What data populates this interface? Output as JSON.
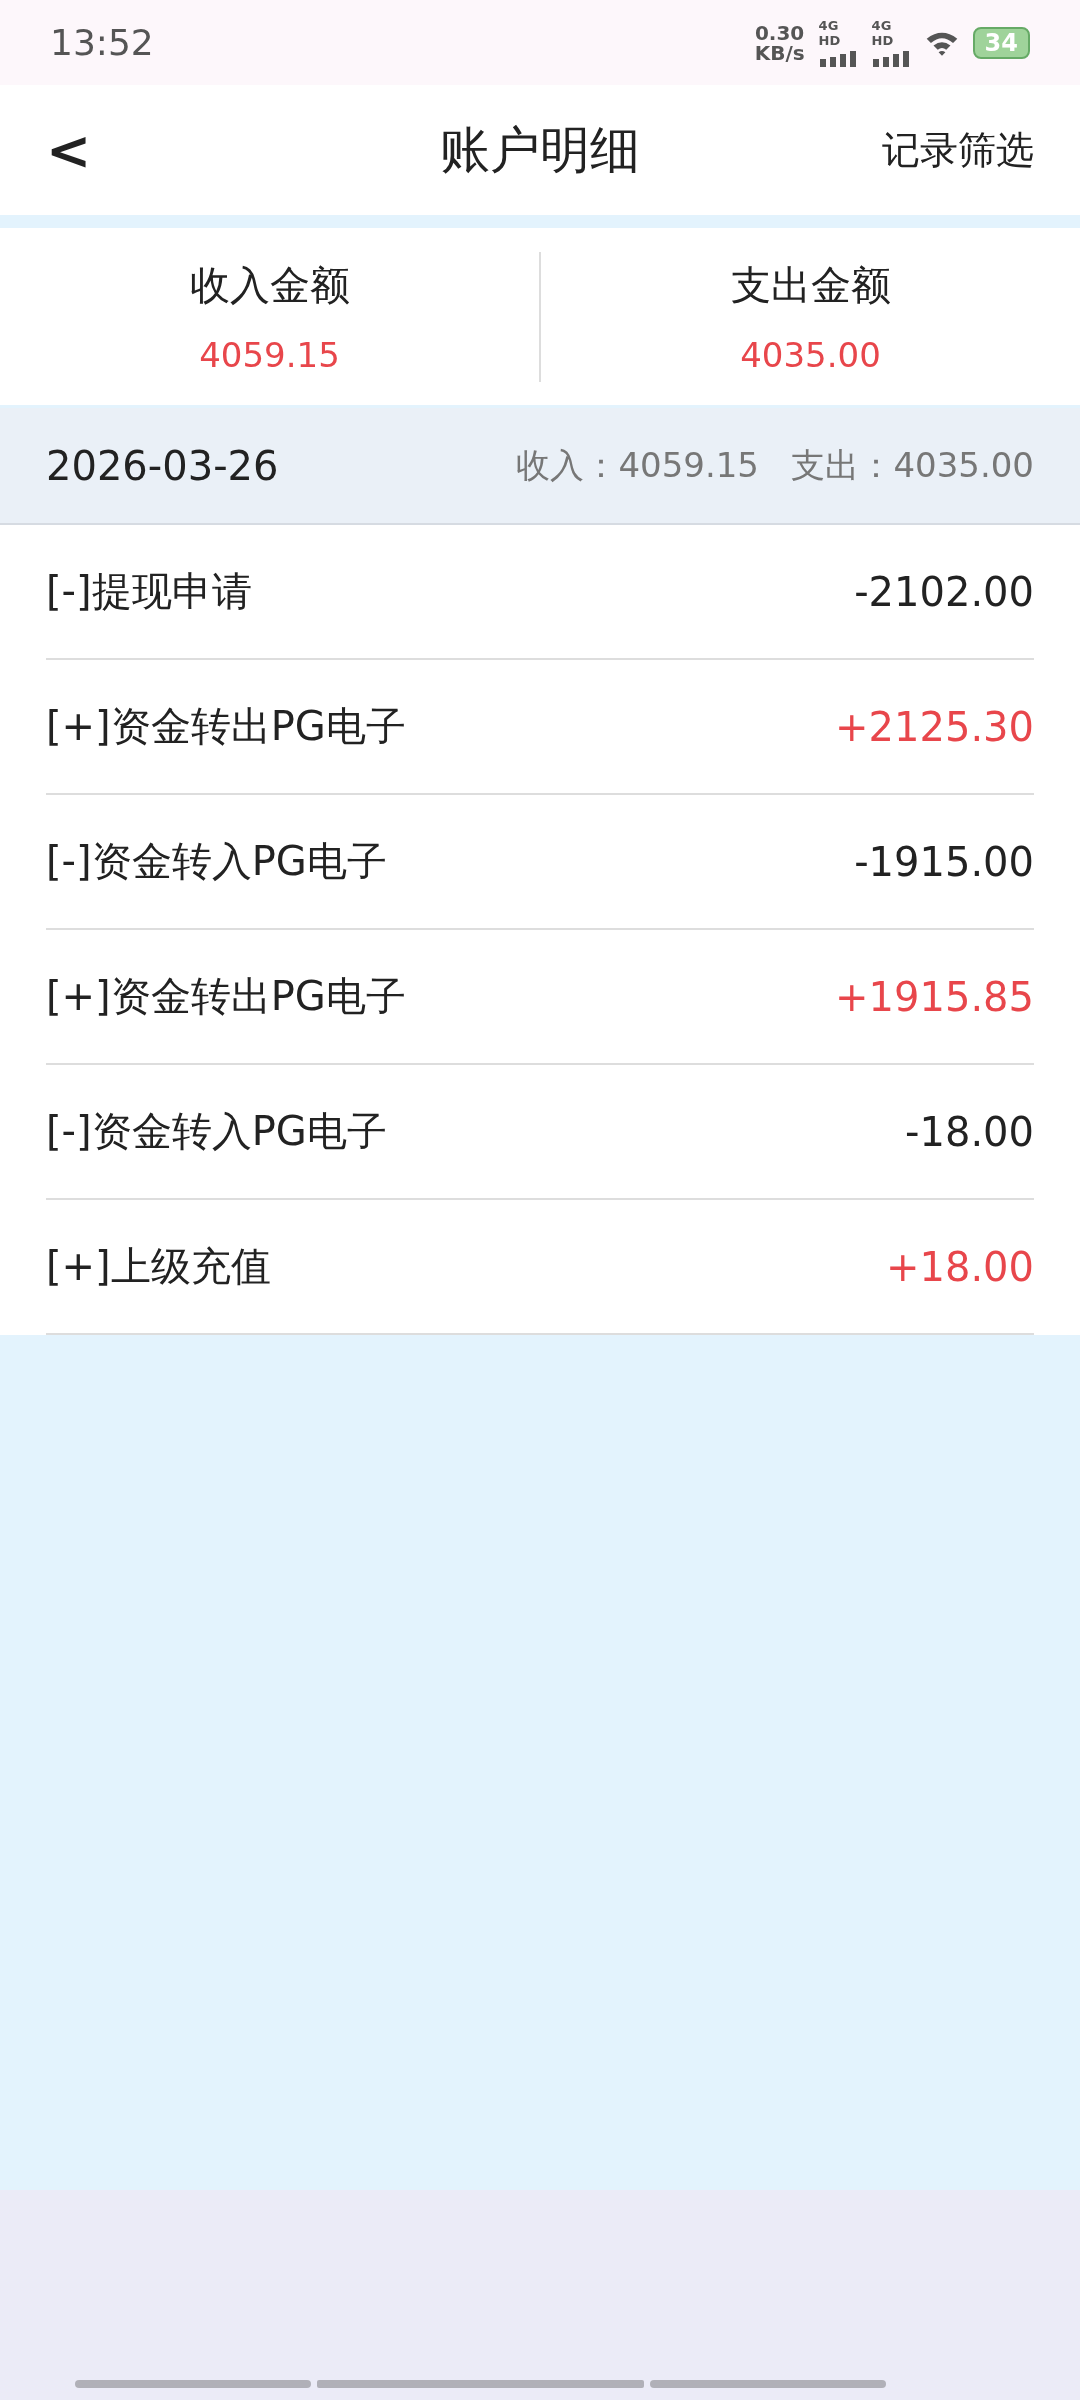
{
  "status_bar": {
    "time": "13:52",
    "speed_value": "0.30",
    "speed_unit": "KB/s",
    "networks": [
      "4G HD",
      "4G HD"
    ],
    "battery": "34"
  },
  "header": {
    "back": "<",
    "title": "账户明细",
    "action": "记录筛选"
  },
  "summary": [
    {
      "label": "收入金额",
      "value": "4059.15"
    },
    {
      "label": "支出金额",
      "value": "4035.00"
    }
  ],
  "day": {
    "date": "2026-03-26",
    "totals": "收入：4059.15   支出：4035.00"
  },
  "records": [
    {
      "kind": "expense",
      "label": "[-]提现申请",
      "amount": "-2102.00"
    },
    {
      "kind": "income",
      "label": "[+]资金转出PG电子",
      "amount": "+2125.30"
    },
    {
      "kind": "expense",
      "label": "[-]资金转入PG电子",
      "amount": "-1915.00"
    },
    {
      "kind": "income",
      "label": "[+]资金转出PG电子",
      "amount": "+1915.85"
    },
    {
      "kind": "expense",
      "label": "[-]资金转入PG电子",
      "amount": "-18.00"
    },
    {
      "kind": "income",
      "label": "[+]上级充值",
      "amount": "+18.00"
    }
  ]
}
